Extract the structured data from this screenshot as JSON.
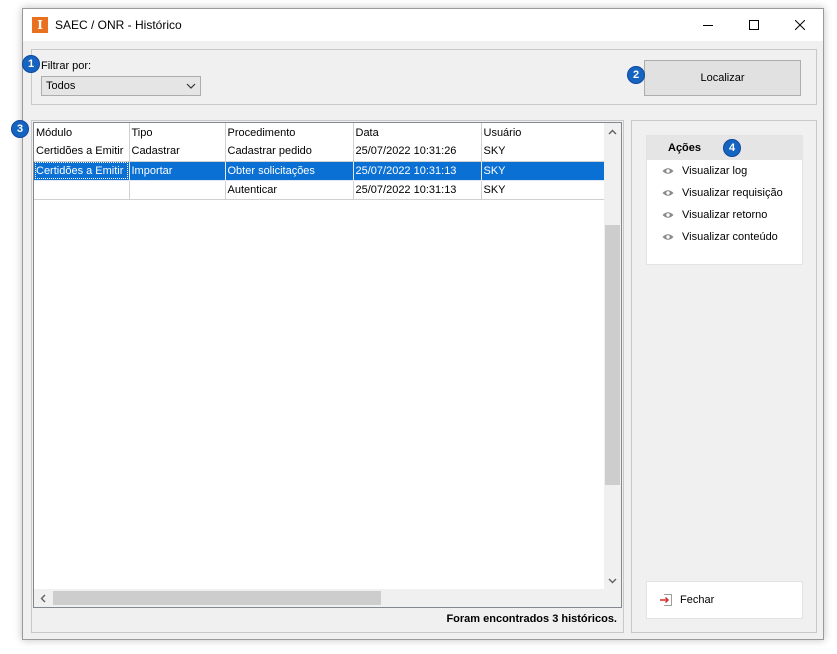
{
  "window": {
    "title": "SAEC / ONR - Histórico",
    "app_icon_letter": "I"
  },
  "filter": {
    "label": "Filtrar por:",
    "selected": "Todos",
    "search_button": "Localizar"
  },
  "badges": [
    "1",
    "2",
    "3",
    "4"
  ],
  "table": {
    "columns": [
      "Módulo",
      "Tipo",
      "Procedimento",
      "Data",
      "Usuário"
    ],
    "rows": [
      [
        "Certidões a Emitir",
        "Cadastrar",
        "Cadastrar pedido",
        "25/07/2022 10:31:26",
        "SKY"
      ],
      [
        "Certidões a Emitir",
        "Importar",
        "Obter solicitações",
        "25/07/2022 10:31:13",
        "SKY"
      ],
      [
        "",
        "",
        "Autenticar",
        "25/07/2022 10:31:13",
        "SKY"
      ]
    ],
    "selected_row": 1,
    "status": "Foram encontrados 3 históricos."
  },
  "actions": {
    "title": "Ações",
    "items": [
      "Visualizar log",
      "Visualizar requisição",
      "Visualizar retorno",
      "Visualizar conteúdo"
    ],
    "close": "Fechar"
  },
  "colors": {
    "selection": "#0a70d4",
    "badge": "#1565c0",
    "app_icon": "#e8701f",
    "close_icon": "#d32f2f"
  },
  "icons": {
    "action": "eye-icon",
    "close": "exit-icon"
  }
}
